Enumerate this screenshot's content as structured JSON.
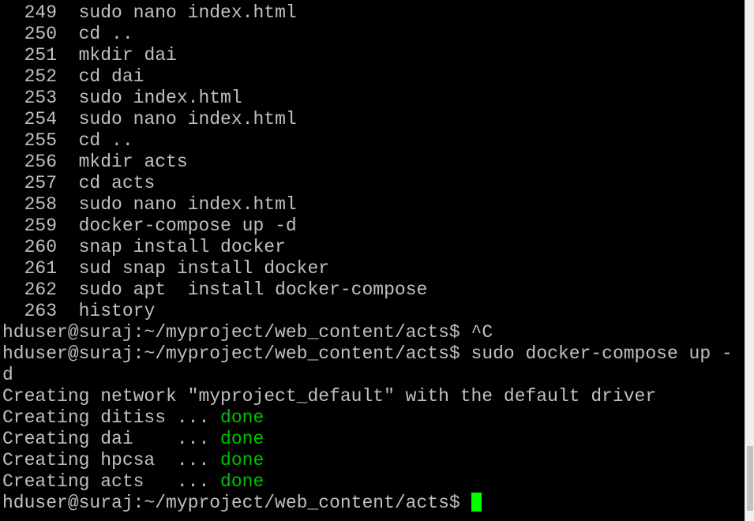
{
  "history": [
    {
      "num": "249",
      "cmd": "sudo nano index.html"
    },
    {
      "num": "250",
      "cmd": "cd .."
    },
    {
      "num": "251",
      "cmd": "mkdir dai"
    },
    {
      "num": "252",
      "cmd": "cd dai"
    },
    {
      "num": "253",
      "cmd": "sudo index.html"
    },
    {
      "num": "254",
      "cmd": "sudo nano index.html"
    },
    {
      "num": "255",
      "cmd": "cd .."
    },
    {
      "num": "256",
      "cmd": "mkdir acts"
    },
    {
      "num": "257",
      "cmd": "cd acts"
    },
    {
      "num": "258",
      "cmd": "sudo nano index.html"
    },
    {
      "num": "259",
      "cmd": "docker-compose up -d"
    },
    {
      "num": "260",
      "cmd": "snap install docker"
    },
    {
      "num": "261",
      "cmd": "sud snap install docker"
    },
    {
      "num": "262",
      "cmd": "sudo apt  install docker-compose"
    },
    {
      "num": "263",
      "cmd": "history"
    }
  ],
  "prompt": "hduser@suraj:~/myproject/web_content/acts$",
  "commands": {
    "interrupt": "^C",
    "compose_up_part1": "sudo docker-compose up -",
    "compose_up_part2": "d"
  },
  "output": {
    "network": "Creating network \"myproject_default\" with the default driver",
    "containers": [
      {
        "label": "Creating ditiss ... ",
        "status": "done"
      },
      {
        "label": "Creating dai    ... ",
        "status": "done"
      },
      {
        "label": "Creating hpcsa  ... ",
        "status": "done"
      },
      {
        "label": "Creating acts   ... ",
        "status": "done"
      }
    ]
  },
  "colors": {
    "background": "#000000",
    "text": "#c0c0c0",
    "success": "#00c000",
    "cursor": "#00ff00"
  }
}
